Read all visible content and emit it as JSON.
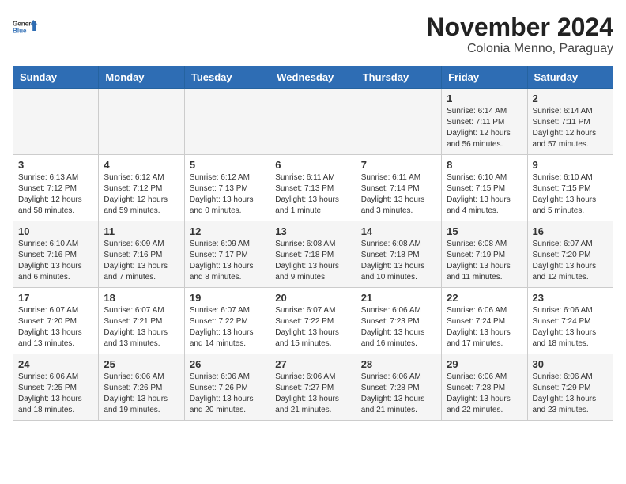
{
  "logo": {
    "line1": "General",
    "line2": "Blue"
  },
  "title": "November 2024",
  "subtitle": "Colonia Menno, Paraguay",
  "days_of_week": [
    "Sunday",
    "Monday",
    "Tuesday",
    "Wednesday",
    "Thursday",
    "Friday",
    "Saturday"
  ],
  "weeks": [
    [
      {
        "day": "",
        "info": ""
      },
      {
        "day": "",
        "info": ""
      },
      {
        "day": "",
        "info": ""
      },
      {
        "day": "",
        "info": ""
      },
      {
        "day": "",
        "info": ""
      },
      {
        "day": "1",
        "info": "Sunrise: 6:14 AM\nSunset: 7:11 PM\nDaylight: 12 hours and 56 minutes."
      },
      {
        "day": "2",
        "info": "Sunrise: 6:14 AM\nSunset: 7:11 PM\nDaylight: 12 hours and 57 minutes."
      }
    ],
    [
      {
        "day": "3",
        "info": "Sunrise: 6:13 AM\nSunset: 7:12 PM\nDaylight: 12 hours and 58 minutes."
      },
      {
        "day": "4",
        "info": "Sunrise: 6:12 AM\nSunset: 7:12 PM\nDaylight: 12 hours and 59 minutes."
      },
      {
        "day": "5",
        "info": "Sunrise: 6:12 AM\nSunset: 7:13 PM\nDaylight: 13 hours and 0 minutes."
      },
      {
        "day": "6",
        "info": "Sunrise: 6:11 AM\nSunset: 7:13 PM\nDaylight: 13 hours and 1 minute."
      },
      {
        "day": "7",
        "info": "Sunrise: 6:11 AM\nSunset: 7:14 PM\nDaylight: 13 hours and 3 minutes."
      },
      {
        "day": "8",
        "info": "Sunrise: 6:10 AM\nSunset: 7:15 PM\nDaylight: 13 hours and 4 minutes."
      },
      {
        "day": "9",
        "info": "Sunrise: 6:10 AM\nSunset: 7:15 PM\nDaylight: 13 hours and 5 minutes."
      }
    ],
    [
      {
        "day": "10",
        "info": "Sunrise: 6:10 AM\nSunset: 7:16 PM\nDaylight: 13 hours and 6 minutes."
      },
      {
        "day": "11",
        "info": "Sunrise: 6:09 AM\nSunset: 7:16 PM\nDaylight: 13 hours and 7 minutes."
      },
      {
        "day": "12",
        "info": "Sunrise: 6:09 AM\nSunset: 7:17 PM\nDaylight: 13 hours and 8 minutes."
      },
      {
        "day": "13",
        "info": "Sunrise: 6:08 AM\nSunset: 7:18 PM\nDaylight: 13 hours and 9 minutes."
      },
      {
        "day": "14",
        "info": "Sunrise: 6:08 AM\nSunset: 7:18 PM\nDaylight: 13 hours and 10 minutes."
      },
      {
        "day": "15",
        "info": "Sunrise: 6:08 AM\nSunset: 7:19 PM\nDaylight: 13 hours and 11 minutes."
      },
      {
        "day": "16",
        "info": "Sunrise: 6:07 AM\nSunset: 7:20 PM\nDaylight: 13 hours and 12 minutes."
      }
    ],
    [
      {
        "day": "17",
        "info": "Sunrise: 6:07 AM\nSunset: 7:20 PM\nDaylight: 13 hours and 13 minutes."
      },
      {
        "day": "18",
        "info": "Sunrise: 6:07 AM\nSunset: 7:21 PM\nDaylight: 13 hours and 13 minutes."
      },
      {
        "day": "19",
        "info": "Sunrise: 6:07 AM\nSunset: 7:22 PM\nDaylight: 13 hours and 14 minutes."
      },
      {
        "day": "20",
        "info": "Sunrise: 6:07 AM\nSunset: 7:22 PM\nDaylight: 13 hours and 15 minutes."
      },
      {
        "day": "21",
        "info": "Sunrise: 6:06 AM\nSunset: 7:23 PM\nDaylight: 13 hours and 16 minutes."
      },
      {
        "day": "22",
        "info": "Sunrise: 6:06 AM\nSunset: 7:24 PM\nDaylight: 13 hours and 17 minutes."
      },
      {
        "day": "23",
        "info": "Sunrise: 6:06 AM\nSunset: 7:24 PM\nDaylight: 13 hours and 18 minutes."
      }
    ],
    [
      {
        "day": "24",
        "info": "Sunrise: 6:06 AM\nSunset: 7:25 PM\nDaylight: 13 hours and 18 minutes."
      },
      {
        "day": "25",
        "info": "Sunrise: 6:06 AM\nSunset: 7:26 PM\nDaylight: 13 hours and 19 minutes."
      },
      {
        "day": "26",
        "info": "Sunrise: 6:06 AM\nSunset: 7:26 PM\nDaylight: 13 hours and 20 minutes."
      },
      {
        "day": "27",
        "info": "Sunrise: 6:06 AM\nSunset: 7:27 PM\nDaylight: 13 hours and 21 minutes."
      },
      {
        "day": "28",
        "info": "Sunrise: 6:06 AM\nSunset: 7:28 PM\nDaylight: 13 hours and 21 minutes."
      },
      {
        "day": "29",
        "info": "Sunrise: 6:06 AM\nSunset: 7:28 PM\nDaylight: 13 hours and 22 minutes."
      },
      {
        "day": "30",
        "info": "Sunrise: 6:06 AM\nSunset: 7:29 PM\nDaylight: 13 hours and 23 minutes."
      }
    ]
  ]
}
